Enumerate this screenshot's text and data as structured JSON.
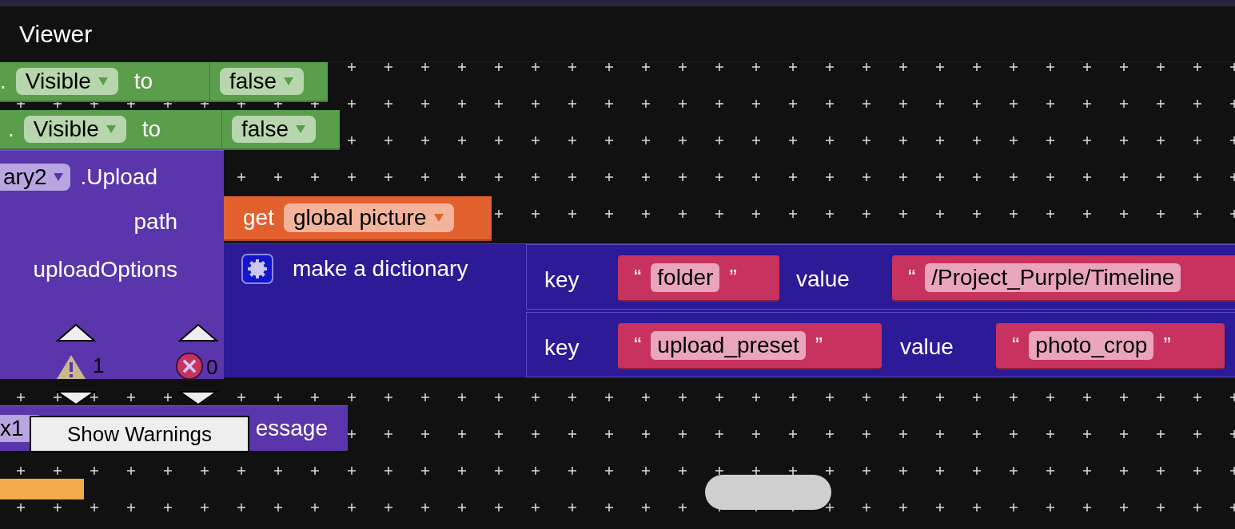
{
  "header": {
    "title": "Viewer"
  },
  "setter_blocks": [
    {
      "dot": ".",
      "property": "Visible",
      "to": "to",
      "value": "false"
    },
    {
      "dot": ".",
      "property": "Visible",
      "to": "to",
      "value": "false"
    }
  ],
  "upload_block": {
    "component": "ary2",
    "method": ".Upload",
    "args": [
      {
        "label": "path"
      },
      {
        "label": "uploadOptions"
      }
    ]
  },
  "get_block": {
    "verb": "get",
    "variable": "global picture"
  },
  "dictionary_block": {
    "label": "make a dictionary",
    "pairs": [
      {
        "key_label": "key",
        "key_open": "“",
        "key": "folder",
        "key_close": "”",
        "value_label": "value",
        "value_open": "“",
        "value": "/Project_Purple/Timeline"
      },
      {
        "key_label": "key",
        "key_open": "“",
        "key": "upload_preset",
        "key_close": "”",
        "value_label": "value",
        "value_open": "“",
        "value": "photo_crop",
        "value_close": "”"
      }
    ]
  },
  "warnings": {
    "warning_count": "1",
    "error_count": "0"
  },
  "partial_block": {
    "component": "x1",
    "text": "essage"
  },
  "tooltip": "Show Warnings"
}
